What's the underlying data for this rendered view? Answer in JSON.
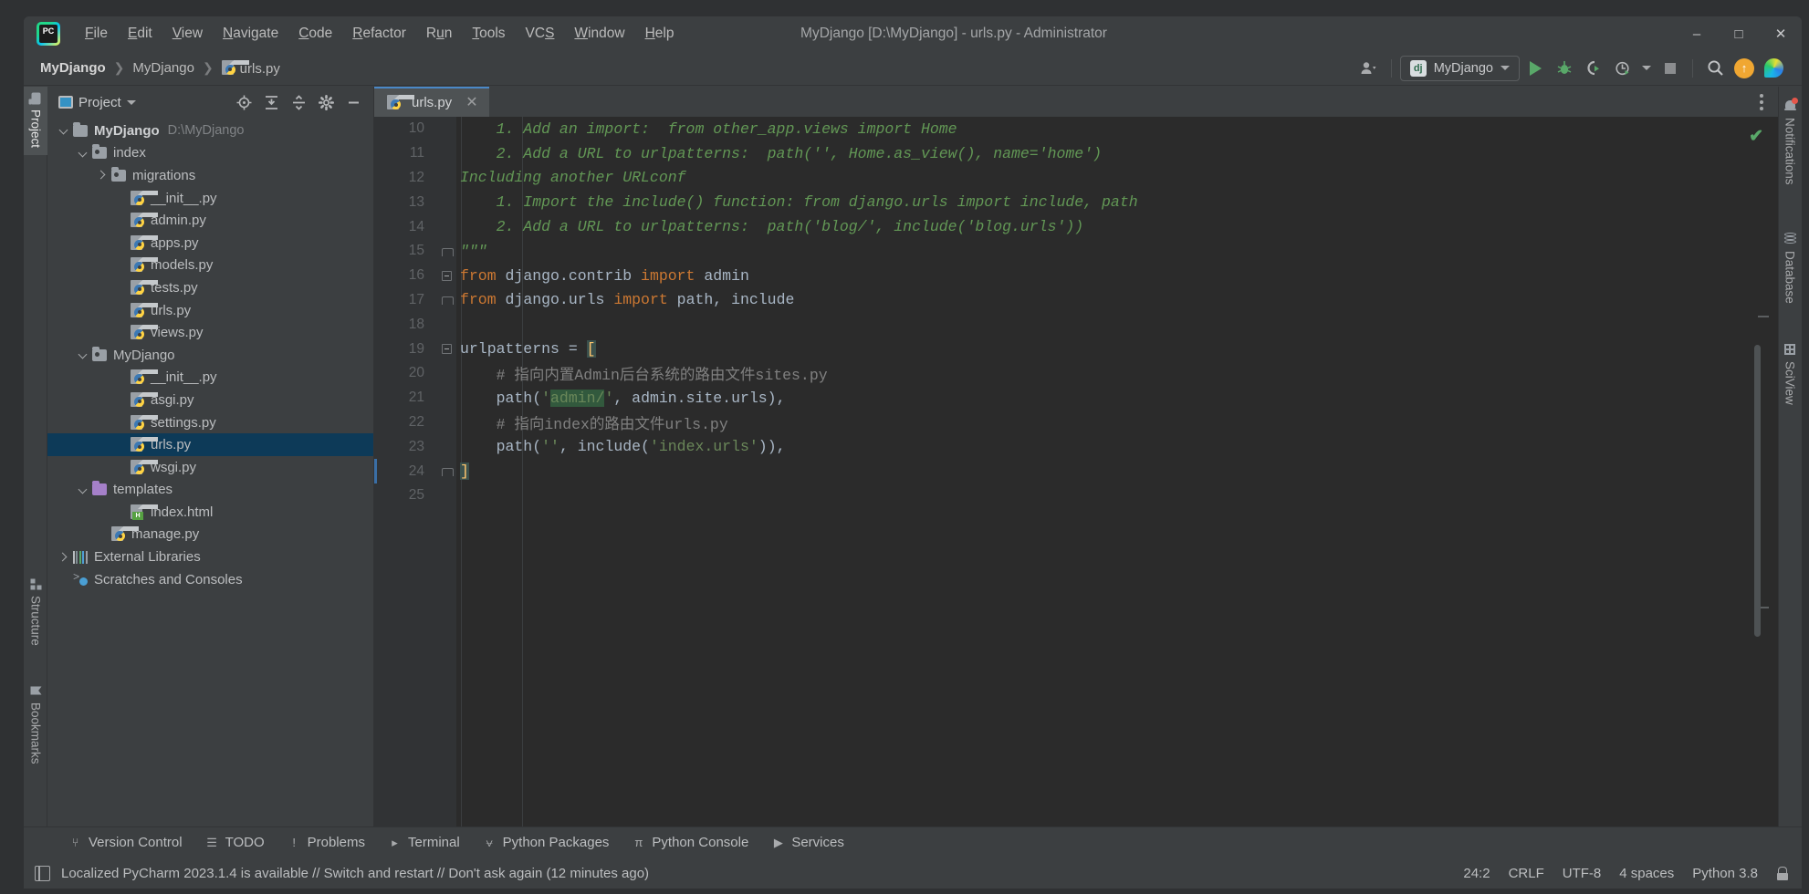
{
  "window": {
    "title": "MyDjango [D:\\MyDjango] - urls.py - Administrator",
    "logo_label": "PC",
    "minimize": "—",
    "maximize": "☐",
    "close": "✕"
  },
  "menu": {
    "items": [
      {
        "label": "File",
        "mnemonic": "F"
      },
      {
        "label": "Edit",
        "mnemonic": "E"
      },
      {
        "label": "View",
        "mnemonic": "V"
      },
      {
        "label": "Navigate",
        "mnemonic": "N"
      },
      {
        "label": "Code",
        "mnemonic": "C"
      },
      {
        "label": "Refactor",
        "mnemonic": "R"
      },
      {
        "label": "Run",
        "mnemonic": "u"
      },
      {
        "label": "Tools",
        "mnemonic": "T"
      },
      {
        "label": "VCS",
        "mnemonic": "S"
      },
      {
        "label": "Window",
        "mnemonic": "W"
      },
      {
        "label": "Help",
        "mnemonic": "H"
      }
    ]
  },
  "breadcrumbs": [
    {
      "label": "MyDjango",
      "icon": "none"
    },
    {
      "label": "MyDjango",
      "icon": "none"
    },
    {
      "label": "urls.py",
      "icon": "python-file-icon"
    }
  ],
  "toolbar": {
    "account_icon": "user-icon",
    "run_config": {
      "badge": "dj",
      "label": "MyDjango",
      "dropdown_icon": "chevron-down-icon"
    },
    "run_icon": "run-icon",
    "debug_icon": "debug-icon",
    "run_coverage_icon": "run-with-coverage-icon",
    "profile_icon": "profile-icon",
    "profile_dropdown_icon": "chevron-down-icon",
    "stop_icon": "stop-icon",
    "search_icon": "search-icon",
    "updates_icon": "update-available-icon",
    "updates_glyph": "↑",
    "ai_icon": "ide-feature-trainer-icon"
  },
  "left_tool_strip": [
    {
      "label": "Project",
      "icon": "project-folder-icon",
      "active": true
    },
    {
      "label": "Structure",
      "icon": "structure-icon",
      "active": false
    },
    {
      "label": "Bookmarks",
      "icon": "bookmark-icon",
      "active": false
    }
  ],
  "right_tool_strip": [
    {
      "label": "Notifications",
      "icon": "bell-icon",
      "badge": true
    },
    {
      "label": "Database",
      "icon": "database-icon",
      "badge": false
    },
    {
      "label": "SciView",
      "icon": "grid-icon",
      "badge": false
    }
  ],
  "project_panel": {
    "title": "Project",
    "title_icon": "project-view-icon",
    "dropdown_icon": "chevron-down-icon",
    "actions": [
      {
        "name": "select-opened-file-icon",
        "glyph": "⊕"
      },
      {
        "name": "expand-all-icon",
        "glyph": "↧"
      },
      {
        "name": "collapse-all-icon",
        "glyph": "↥"
      },
      {
        "name": "settings-gear-icon",
        "glyph": "⚙"
      },
      {
        "name": "hide-panel-icon",
        "glyph": "—"
      }
    ],
    "tree": [
      {
        "label": "MyDjango",
        "path": "D:\\MyDjango",
        "indent": 0,
        "chevron": "down",
        "icon": "folder",
        "bold": true,
        "selected": false
      },
      {
        "label": "index",
        "path": "",
        "indent": 1,
        "chevron": "down",
        "icon": "package",
        "bold": false,
        "selected": false
      },
      {
        "label": "migrations",
        "path": "",
        "indent": 2,
        "chevron": "right",
        "icon": "package",
        "bold": false,
        "selected": false
      },
      {
        "label": "__init__.py",
        "path": "",
        "indent": 3,
        "chevron": "none",
        "icon": "python",
        "bold": false,
        "selected": false
      },
      {
        "label": "admin.py",
        "path": "",
        "indent": 3,
        "chevron": "none",
        "icon": "python",
        "bold": false,
        "selected": false
      },
      {
        "label": "apps.py",
        "path": "",
        "indent": 3,
        "chevron": "none",
        "icon": "python",
        "bold": false,
        "selected": false
      },
      {
        "label": "models.py",
        "path": "",
        "indent": 3,
        "chevron": "none",
        "icon": "python",
        "bold": false,
        "selected": false
      },
      {
        "label": "tests.py",
        "path": "",
        "indent": 3,
        "chevron": "none",
        "icon": "python",
        "bold": false,
        "selected": false
      },
      {
        "label": "urls.py",
        "path": "",
        "indent": 3,
        "chevron": "none",
        "icon": "python",
        "bold": false,
        "selected": false
      },
      {
        "label": "views.py",
        "path": "",
        "indent": 3,
        "chevron": "none",
        "icon": "python",
        "bold": false,
        "selected": false
      },
      {
        "label": "MyDjango",
        "path": "",
        "indent": 1,
        "chevron": "down",
        "icon": "package",
        "bold": false,
        "selected": false
      },
      {
        "label": "__init__.py",
        "path": "",
        "indent": 3,
        "chevron": "none",
        "icon": "python",
        "bold": false,
        "selected": false
      },
      {
        "label": "asgi.py",
        "path": "",
        "indent": 3,
        "chevron": "none",
        "icon": "python",
        "bold": false,
        "selected": false
      },
      {
        "label": "settings.py",
        "path": "",
        "indent": 3,
        "chevron": "none",
        "icon": "python",
        "bold": false,
        "selected": false
      },
      {
        "label": "urls.py",
        "path": "",
        "indent": 3,
        "chevron": "none",
        "icon": "python",
        "bold": false,
        "selected": true
      },
      {
        "label": "wsgi.py",
        "path": "",
        "indent": 3,
        "chevron": "none",
        "icon": "python",
        "bold": false,
        "selected": false
      },
      {
        "label": "templates",
        "path": "",
        "indent": 1,
        "chevron": "down",
        "icon": "template-folder",
        "bold": false,
        "selected": false
      },
      {
        "label": "index.html",
        "path": "",
        "indent": 3,
        "chevron": "none",
        "icon": "html",
        "bold": false,
        "selected": false
      },
      {
        "label": "manage.py",
        "path": "",
        "indent": 2,
        "chevron": "none",
        "icon": "python",
        "bold": false,
        "selected": false
      },
      {
        "label": "External Libraries",
        "path": "",
        "indent": 0,
        "chevron": "right",
        "icon": "libraries",
        "bold": false,
        "selected": false
      },
      {
        "label": "Scratches and Consoles",
        "path": "",
        "indent": 0,
        "chevron": "none",
        "icon": "scratch",
        "bold": false,
        "selected": false
      }
    ]
  },
  "editor": {
    "tab": {
      "label": "urls.py",
      "icon": "python-file-icon",
      "close_icon": "close-icon"
    },
    "options_icon": "kebab-menu-icon",
    "inspection_status_icon": "inspection-ok-checkmark",
    "lines": [
      {
        "num": "10",
        "fold": "none",
        "tokens": [
          {
            "t": "    1. Add an import:  from other_app.views import Home",
            "c": "s-doc"
          }
        ]
      },
      {
        "num": "11",
        "fold": "none",
        "tokens": [
          {
            "t": "    2. Add a URL to urlpatterns:  path('', Home.as_view(), name='home')",
            "c": "s-doc"
          }
        ]
      },
      {
        "num": "12",
        "fold": "none",
        "tokens": [
          {
            "t": "Including another URLconf",
            "c": "s-doc"
          }
        ]
      },
      {
        "num": "13",
        "fold": "none",
        "tokens": [
          {
            "t": "    1. Import the include() function: from django.urls import include, path",
            "c": "s-doc"
          }
        ]
      },
      {
        "num": "14",
        "fold": "none",
        "tokens": [
          {
            "t": "    2. Add a URL to urlpatterns:  path('blog/', include('blog.urls'))",
            "c": "s-doc"
          }
        ]
      },
      {
        "num": "15",
        "fold": "cap",
        "tokens": [
          {
            "t": "\"\"\"",
            "c": "s-doc"
          }
        ]
      },
      {
        "num": "16",
        "fold": "box",
        "tokens": [
          {
            "t": "from",
            "c": "s-kw"
          },
          {
            "t": " django.contrib ",
            "c": "s-txt"
          },
          {
            "t": "import",
            "c": "s-kw"
          },
          {
            "t": " admin",
            "c": "s-txt"
          }
        ]
      },
      {
        "num": "17",
        "fold": "cap",
        "tokens": [
          {
            "t": "from",
            "c": "s-kw"
          },
          {
            "t": " django.urls ",
            "c": "s-txt"
          },
          {
            "t": "import",
            "c": "s-kw"
          },
          {
            "t": " path, include",
            "c": "s-txt"
          }
        ]
      },
      {
        "num": "18",
        "fold": "none",
        "tokens": [
          {
            "t": "",
            "c": "s-txt"
          }
        ]
      },
      {
        "num": "19",
        "fold": "box",
        "tokens": [
          {
            "t": "urlpatterns = ",
            "c": "s-txt"
          },
          {
            "t": "[",
            "c": "hl-brace"
          }
        ]
      },
      {
        "num": "20",
        "fold": "none",
        "tokens": [
          {
            "t": "    # 指向内置Admin后台系统的路由文件sites.py",
            "c": "s-cmt"
          }
        ]
      },
      {
        "num": "21",
        "fold": "none",
        "tokens": [
          {
            "t": "    path(",
            "c": "s-txt"
          },
          {
            "t": "'",
            "c": "s-str"
          },
          {
            "t": "admin/",
            "c": "s-str hl-search"
          },
          {
            "t": "'",
            "c": "s-str"
          },
          {
            "t": ", admin.site.urls),",
            "c": "s-txt"
          }
        ]
      },
      {
        "num": "22",
        "fold": "none",
        "tokens": [
          {
            "t": "    # 指向index的路由文件urls.py",
            "c": "s-cmt"
          }
        ]
      },
      {
        "num": "23",
        "fold": "none",
        "tokens": [
          {
            "t": "    path(",
            "c": "s-txt"
          },
          {
            "t": "''",
            "c": "s-str"
          },
          {
            "t": ", include(",
            "c": "s-txt"
          },
          {
            "t": "'index.urls'",
            "c": "s-str"
          },
          {
            "t": ")),",
            "c": "s-txt"
          }
        ]
      },
      {
        "num": "24",
        "fold": "cap",
        "tokens": [
          {
            "t": "]",
            "c": "hl-brace"
          }
        ],
        "caret": true
      },
      {
        "num": "25",
        "fold": "none",
        "tokens": [
          {
            "t": "",
            "c": "s-txt"
          }
        ]
      }
    ]
  },
  "bottom_bar": {
    "tabs": [
      {
        "label": "Version Control",
        "icon": "branch-icon",
        "glyph": "⑂"
      },
      {
        "label": "TODO",
        "icon": "todo-list-icon",
        "glyph": "☰"
      },
      {
        "label": "Problems",
        "icon": "problems-icon",
        "glyph": "!"
      },
      {
        "label": "Terminal",
        "icon": "terminal-icon",
        "glyph": "▸"
      },
      {
        "label": "Python Packages",
        "icon": "packages-icon",
        "glyph": "⩝"
      },
      {
        "label": "Python Console",
        "icon": "python-console-icon",
        "glyph": "π"
      },
      {
        "label": "Services",
        "icon": "services-icon",
        "glyph": "▶"
      }
    ]
  },
  "status_bar": {
    "message_icon": "ide-notification-icon",
    "message": "Localized PyCharm 2023.1.4 is available // Switch and restart // Don't ask again (12 minutes ago)",
    "caret_position": "24:2",
    "line_separator": "CRLF",
    "encoding": "UTF-8",
    "indent": "4 spaces",
    "interpreter": "Python 3.8",
    "lock_icon": "unlocked-icon"
  },
  "colors": {
    "accent_blue": "#4a88c7",
    "selection_blue": "#0d3a58",
    "run_green": "#59a869",
    "chrome": "#3c3f41",
    "editor_bg": "#2b2b2b",
    "keyword_orange": "#cc7832",
    "string_green": "#6a8759",
    "doc_green": "#629755",
    "comment_gray": "#808080"
  }
}
